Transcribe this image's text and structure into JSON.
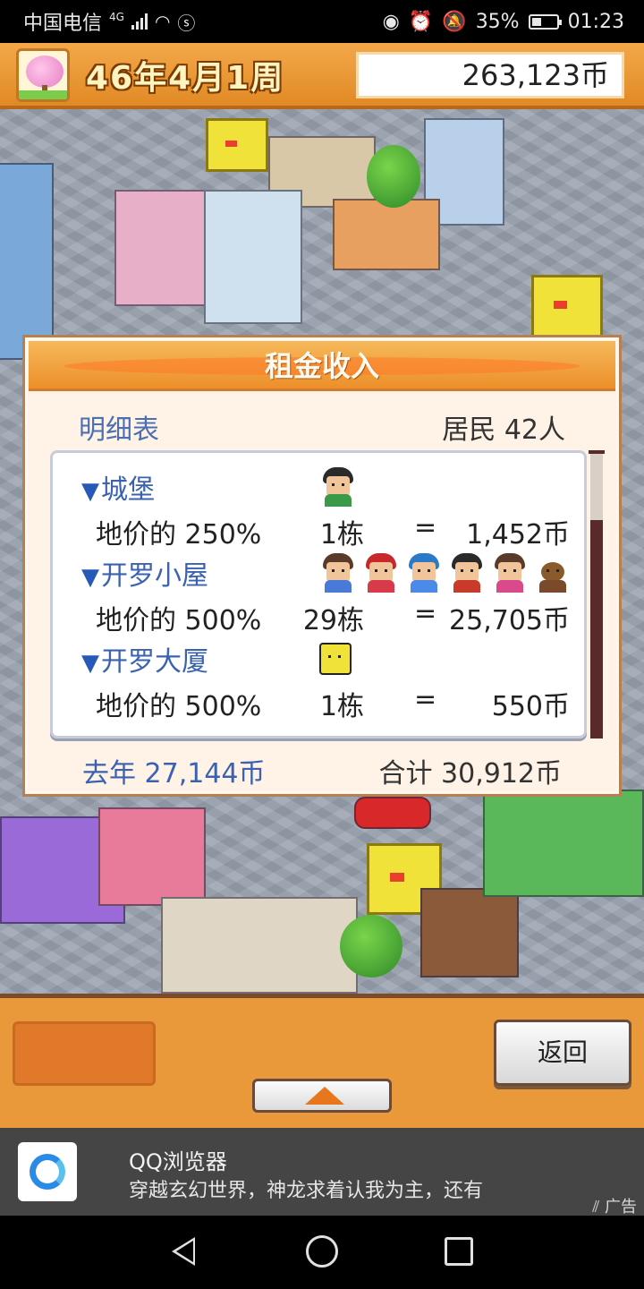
{
  "status_bar": {
    "carrier": "中国电信",
    "network": "4G",
    "battery": "35%",
    "time": "01:23"
  },
  "top_bar": {
    "date": "46年4月1周",
    "money": "263,123币"
  },
  "dialog": {
    "title": "租金收入",
    "detail_label": "明细表",
    "residents": "居民 42人",
    "categories": [
      {
        "name": "城堡",
        "rate": "地价的 250%",
        "count": "1栋",
        "equals": "=",
        "amount": "1,452币"
      },
      {
        "name": "开罗小屋",
        "rate": "地价的 500%",
        "count": "29栋",
        "equals": "=",
        "amount": "25,705币"
      },
      {
        "name": "开罗大厦",
        "rate": "地价的 500%",
        "count": "1栋",
        "equals": "=",
        "amount": "550币"
      }
    ],
    "last_year": "去年 27,144币",
    "total": "合计 30,912币",
    "scroll_position": 1.0
  },
  "panel": {
    "back_label": "返回"
  },
  "ad": {
    "title": "QQ浏览器",
    "description": "穿越玄幻世界，神龙求着认我为主，还有",
    "tag": "广告"
  },
  "colors": {
    "accent_orange": "#ec8f2a",
    "link_blue": "#3a62b0",
    "dialog_bg": "#fff2e6"
  }
}
